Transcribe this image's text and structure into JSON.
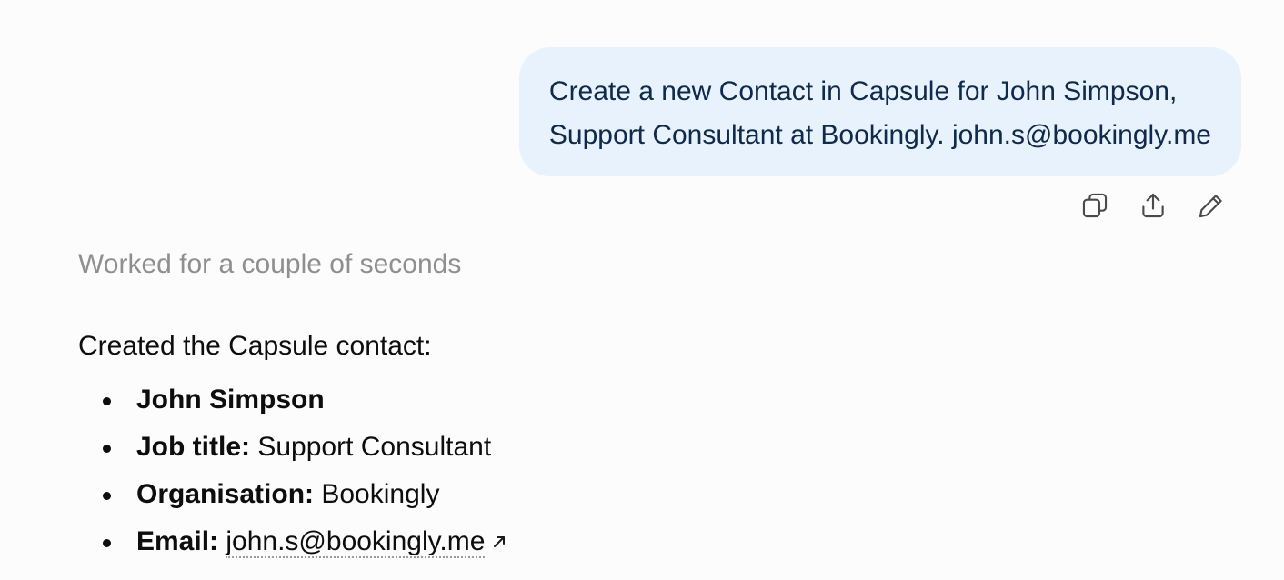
{
  "user_message": {
    "line1": "Create a new Contact in Capsule for John Simpson,",
    "line2": "Support Consultant at Bookingly. john.s@bookingly.me"
  },
  "message_actions": {
    "copy_icon": "copy-icon",
    "share_icon": "share-icon",
    "edit_icon": "edit-pencil-icon"
  },
  "assistant": {
    "worked_status": "Worked for a couple of seconds",
    "intro": "Created the Capsule contact:",
    "contact": {
      "name": "John Simpson",
      "job_title_label": "Job title:",
      "job_title": "Support Consultant",
      "organisation_label": "Organisation:",
      "organisation": "Bookingly",
      "email_label": "Email:",
      "email": "john.s@bookingly.me",
      "email_icon": "external-link-arrow-icon"
    }
  },
  "colors": {
    "background": "#fcfcfc",
    "user_bubble": "#e8f2fd",
    "user_text": "#0f2a4a",
    "muted_text": "#8f8f8f"
  }
}
